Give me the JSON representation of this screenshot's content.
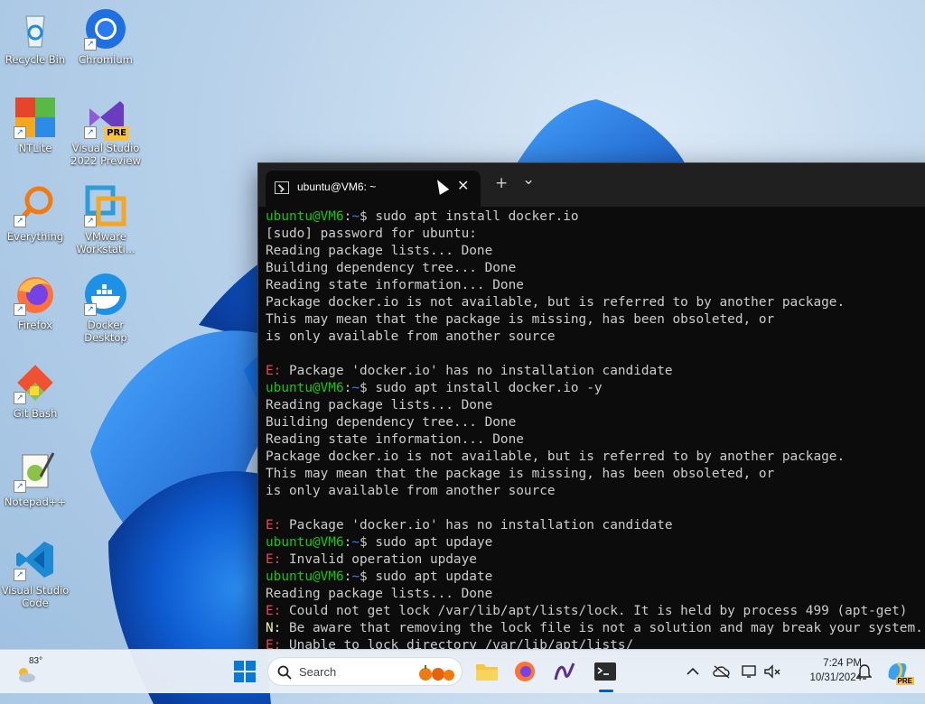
{
  "desktop": {
    "icons": [
      {
        "label": "Recycle Bin"
      },
      {
        "label": "Chromium"
      },
      {
        "label": "NTLite"
      },
      {
        "label": "Visual Studio 2022 Preview"
      },
      {
        "label": "Everything"
      },
      {
        "label": "VMware Workstati..."
      },
      {
        "label": "Firefox"
      },
      {
        "label": "Docker Desktop"
      },
      {
        "label": "Git Bash"
      },
      {
        "label": "Notepad++"
      },
      {
        "label": "Visual Studio Code"
      }
    ],
    "vs_badge": "PRE"
  },
  "terminal": {
    "tab_title": "ubuntu@VM6: ~",
    "close_glyph": "✕",
    "new_tab_glyph": "+",
    "dropdown_glyph": "⌄",
    "prompt_user": "ubuntu@VM6",
    "prompt_sep": ":",
    "prompt_path": "~",
    "prompt_dollar": "$ ",
    "err_prefix": "E:",
    "note_prefix": "N:",
    "lines": [
      {
        "kind": "prompt",
        "text": "sudo apt install docker.io"
      },
      {
        "kind": "out",
        "text": "[sudo] password for ubuntu:"
      },
      {
        "kind": "out",
        "text": "Reading package lists... Done"
      },
      {
        "kind": "out",
        "text": "Building dependency tree... Done"
      },
      {
        "kind": "out",
        "text": "Reading state information... Done"
      },
      {
        "kind": "out",
        "text": "Package docker.io is not available, but is referred to by another package."
      },
      {
        "kind": "out",
        "text": "This may mean that the package is missing, has been obsoleted, or"
      },
      {
        "kind": "out",
        "text": "is only available from another source"
      },
      {
        "kind": "out",
        "text": ""
      },
      {
        "kind": "err",
        "text": " Package 'docker.io' has no installation candidate"
      },
      {
        "kind": "prompt",
        "text": "sudo apt install docker.io -y"
      },
      {
        "kind": "out",
        "text": "Reading package lists... Done"
      },
      {
        "kind": "out",
        "text": "Building dependency tree... Done"
      },
      {
        "kind": "out",
        "text": "Reading state information... Done"
      },
      {
        "kind": "out",
        "text": "Package docker.io is not available, but is referred to by another package."
      },
      {
        "kind": "out",
        "text": "This may mean that the package is missing, has been obsoleted, or"
      },
      {
        "kind": "out",
        "text": "is only available from another source"
      },
      {
        "kind": "out",
        "text": ""
      },
      {
        "kind": "err",
        "text": " Package 'docker.io' has no installation candidate"
      },
      {
        "kind": "prompt",
        "text": "sudo apt updaye"
      },
      {
        "kind": "err",
        "text": " Invalid operation updaye"
      },
      {
        "kind": "prompt",
        "text": "sudo apt update"
      },
      {
        "kind": "out",
        "text": "Reading package lists... Done"
      },
      {
        "kind": "err",
        "text": " Could not get lock /var/lib/apt/lists/lock. It is held by process 499 (apt-get)"
      },
      {
        "kind": "note",
        "text": " Be aware that removing the lock file is not a solution and may break your system."
      },
      {
        "kind": "err",
        "text": " Unable to lock directory /var/lib/apt/lists/"
      }
    ]
  },
  "taskbar": {
    "weather_temp": "83°",
    "search_placeholder": "Search",
    "time": "7:24 PM",
    "date": "10/31/2024",
    "copilot_badge": "PRE"
  },
  "colors": {
    "prompt_user": "#16c60c",
    "prompt_path": "#3b78ff",
    "error": "#e74856",
    "note": "#f9f1a5",
    "accent": "#005fb8"
  }
}
